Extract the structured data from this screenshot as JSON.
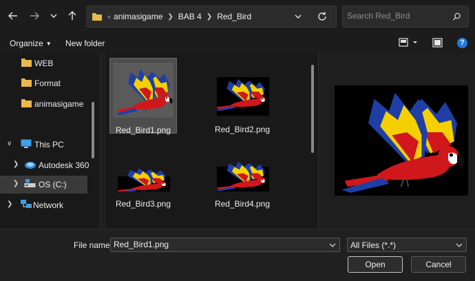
{
  "nav": {
    "back_icon": "arrow-left-icon",
    "forward_icon": "arrow-right-icon",
    "recent_icon": "chevron-down-icon",
    "up_icon": "arrow-up-icon",
    "breadcrumb": [
      "animasigame",
      "BAB 4",
      "Red_Bird"
    ],
    "breadcrumb_overflow": "«"
  },
  "search": {
    "placeholder": "Search Red_Bird"
  },
  "toolbar": {
    "organize_label": "Organize",
    "new_folder_label": "New folder",
    "help_label": "?"
  },
  "sidebar": {
    "items": [
      {
        "label": "WEB",
        "icon": "folder-icon"
      },
      {
        "label": "Format",
        "icon": "folder-icon"
      },
      {
        "label": "animasigame",
        "icon": "folder-icon"
      },
      {
        "label": "This PC",
        "icon": "computer-icon"
      },
      {
        "label": "Autodesk 360",
        "icon": "cloud-icon"
      },
      {
        "label": "OS (C:)",
        "icon": "drive-icon"
      },
      {
        "label": "Network",
        "icon": "network-icon"
      }
    ]
  },
  "files": [
    {
      "name": "Red_Bird1.png",
      "selected": true
    },
    {
      "name": "Red_Bird2.png",
      "selected": false
    },
    {
      "name": "Red_Bird3.png",
      "selected": false
    },
    {
      "name": "Red_Bird4.png",
      "selected": false
    }
  ],
  "bottom": {
    "file_name_label": "File name:",
    "file_name_value": "Red_Bird1.png",
    "file_type_value": "All Files (*.*)",
    "open_label": "Open",
    "cancel_label": "Cancel"
  },
  "colors": {
    "bird_red": "#d0181c",
    "bird_yellow": "#f5d000",
    "bird_blue": "#1f3fa6",
    "accent": "#1f7ae0"
  }
}
